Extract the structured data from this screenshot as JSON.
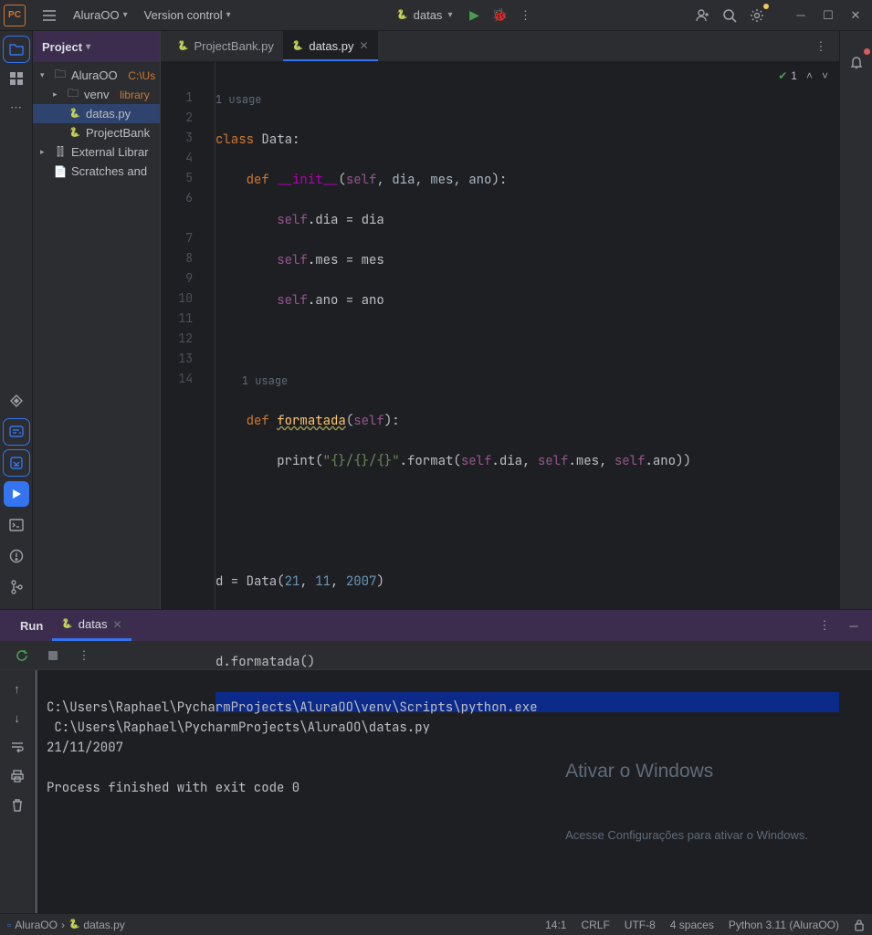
{
  "titlebar": {
    "project_name": "AluraOO",
    "vcs_label": "Version control",
    "run_config": "datas"
  },
  "project": {
    "header": "Project",
    "root": "AluraOO",
    "root_hint": "C:\\Us",
    "venv": "venv",
    "venv_hint": "library",
    "datas_file": "datas.py",
    "projectbank_file": "ProjectBank",
    "ext_lib": "External Librar",
    "scratches": "Scratches and"
  },
  "editor": {
    "tab1": "ProjectBank.py",
    "tab2": "datas.py",
    "usage1": "1 usage",
    "usage2": "1 usage",
    "check_count": "1",
    "lines": [
      "1",
      "2",
      "3",
      "4",
      "5",
      "6",
      "7",
      "8",
      "9",
      "10",
      "11",
      "12",
      "13",
      "14"
    ]
  },
  "code": {
    "l1_class": "class",
    "l1_name": " Data",
    "l1_colon": ":",
    "l2_def": "def",
    "l2_dunder": "__init__",
    "l2_open": "(",
    "l2_self": "self",
    "l2_p": ", dia, mes, ano",
    "l2_close": "):",
    "l3_self": "self",
    "l3_rest": ".dia = dia",
    "l4_self": "self",
    "l4_rest": ".mes = mes",
    "l5_self": "self",
    "l5_rest": ".ano = ano",
    "l7_def": "def",
    "l7_name": "formatada",
    "l7_open": "(",
    "l7_self": "self",
    "l7_close": "):",
    "l8_print": "print(",
    "l8_str": "\"{}/{}/{}\"",
    "l8_fmt": ".format(",
    "l8_self1": "self",
    "l8_d": ".dia",
    "l8_c1": ", ",
    "l8_self2": "self",
    "l8_m": ".mes",
    "l8_c2": ", ",
    "l8_self3": "self",
    "l8_a": ".ano",
    "l8_end": "))",
    "l11_pre": "d = Data(",
    "l11_a": "21",
    "l11_c1": ", ",
    "l11_b": "11",
    "l11_c2": ", ",
    "l11_c": "2007",
    "l11_end": ")",
    "l13": "d.formatada()"
  },
  "run": {
    "label": "Run",
    "tab": "datas",
    "console_line1": "C:\\Users\\Raphael\\PycharmProjects\\AluraOO\\venv\\Scripts\\python.exe ",
    "console_line2": " C:\\Users\\Raphael\\PycharmProjects\\AluraOO\\datas.py ",
    "console_line3": "21/11/2007",
    "console_line5": "Process finished with exit code 0"
  },
  "watermark": {
    "title": "Ativar o Windows",
    "sub": "Acesse Configurações para ativar o Windows."
  },
  "status": {
    "crumb1": "AluraOO",
    "crumb2": "datas.py",
    "pos": "14:1",
    "eol": "CRLF",
    "enc": "UTF-8",
    "indent": "4 spaces",
    "interp": "Python 3.11 (AluraOO)"
  }
}
